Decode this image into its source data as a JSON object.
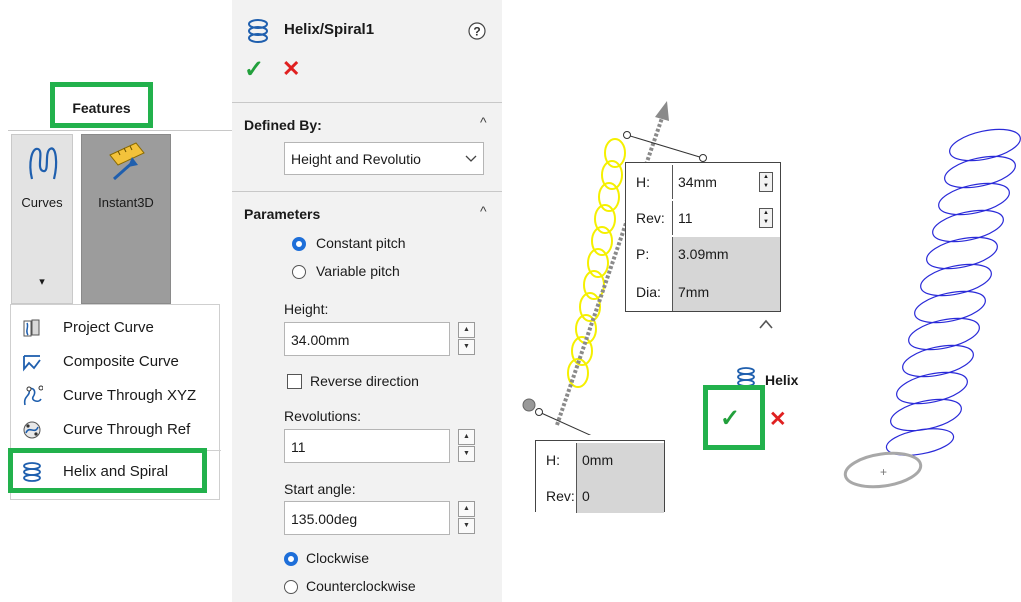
{
  "ribbon": {
    "features_tab": "Features",
    "curves_label": "Curves",
    "instant3d_label": "Instant3D",
    "caret": "▾"
  },
  "menu": {
    "items": [
      {
        "label": "Project Curve",
        "icon": "project-curve-icon"
      },
      {
        "label": "Composite Curve",
        "icon": "composite-curve-icon"
      },
      {
        "label": "Curve Through XYZ",
        "icon": "curve-through-xyz-icon"
      },
      {
        "label": "Curve Through Ref",
        "icon": "curve-through-reference-icon"
      },
      {
        "label": "Helix and Spiral",
        "icon": "helix-icon"
      }
    ]
  },
  "property_manager": {
    "title": "Helix/Spiral1",
    "help": "?",
    "ok": "✓",
    "cancel": "✕",
    "defined_by": {
      "header": "Defined By:",
      "value": "Height and Revolutio"
    },
    "parameters": {
      "header": "Parameters",
      "constant_pitch": "Constant pitch",
      "variable_pitch": "Variable pitch",
      "height_label": "Height:",
      "height_value": "34.00mm",
      "reverse_direction": "Reverse direction",
      "revolutions_label": "Revolutions:",
      "revolutions_value": "11",
      "start_angle_label": "Start angle:",
      "start_angle_value": "135.00deg",
      "clockwise": "Clockwise",
      "counterclockwise": "Counterclockwise"
    }
  },
  "preview": {
    "top_callout": {
      "h_key": "H:",
      "h_value": "34mm",
      "rev_key": "Rev:",
      "rev_value": "11",
      "p_key": "P:",
      "p_value": "3.09mm",
      "dia_key": "Dia:",
      "dia_value": "7mm"
    },
    "bottom_callout": {
      "h_key": "H:",
      "h_value": "0mm",
      "rev_key": "Rev:",
      "rev_value": "0"
    },
    "mini_title": "Helix",
    "colors": {
      "helix_preview": "#ffff00",
      "helix_result": "#2a2ad8",
      "accent_green": "#22b14c",
      "cancel_red": "#e02020"
    }
  }
}
